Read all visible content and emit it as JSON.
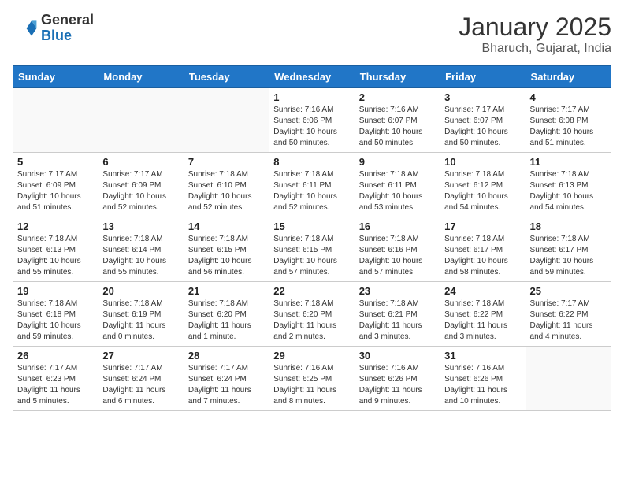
{
  "header": {
    "logo_line1": "General",
    "logo_line2": "Blue",
    "month_year": "January 2025",
    "location": "Bharuch, Gujarat, India"
  },
  "weekdays": [
    "Sunday",
    "Monday",
    "Tuesday",
    "Wednesday",
    "Thursday",
    "Friday",
    "Saturday"
  ],
  "weeks": [
    [
      {
        "day": "",
        "info": ""
      },
      {
        "day": "",
        "info": ""
      },
      {
        "day": "",
        "info": ""
      },
      {
        "day": "1",
        "info": "Sunrise: 7:16 AM\nSunset: 6:06 PM\nDaylight: 10 hours\nand 50 minutes."
      },
      {
        "day": "2",
        "info": "Sunrise: 7:16 AM\nSunset: 6:07 PM\nDaylight: 10 hours\nand 50 minutes."
      },
      {
        "day": "3",
        "info": "Sunrise: 7:17 AM\nSunset: 6:07 PM\nDaylight: 10 hours\nand 50 minutes."
      },
      {
        "day": "4",
        "info": "Sunrise: 7:17 AM\nSunset: 6:08 PM\nDaylight: 10 hours\nand 51 minutes."
      }
    ],
    [
      {
        "day": "5",
        "info": "Sunrise: 7:17 AM\nSunset: 6:09 PM\nDaylight: 10 hours\nand 51 minutes."
      },
      {
        "day": "6",
        "info": "Sunrise: 7:17 AM\nSunset: 6:09 PM\nDaylight: 10 hours\nand 52 minutes."
      },
      {
        "day": "7",
        "info": "Sunrise: 7:18 AM\nSunset: 6:10 PM\nDaylight: 10 hours\nand 52 minutes."
      },
      {
        "day": "8",
        "info": "Sunrise: 7:18 AM\nSunset: 6:11 PM\nDaylight: 10 hours\nand 52 minutes."
      },
      {
        "day": "9",
        "info": "Sunrise: 7:18 AM\nSunset: 6:11 PM\nDaylight: 10 hours\nand 53 minutes."
      },
      {
        "day": "10",
        "info": "Sunrise: 7:18 AM\nSunset: 6:12 PM\nDaylight: 10 hours\nand 54 minutes."
      },
      {
        "day": "11",
        "info": "Sunrise: 7:18 AM\nSunset: 6:13 PM\nDaylight: 10 hours\nand 54 minutes."
      }
    ],
    [
      {
        "day": "12",
        "info": "Sunrise: 7:18 AM\nSunset: 6:13 PM\nDaylight: 10 hours\nand 55 minutes."
      },
      {
        "day": "13",
        "info": "Sunrise: 7:18 AM\nSunset: 6:14 PM\nDaylight: 10 hours\nand 55 minutes."
      },
      {
        "day": "14",
        "info": "Sunrise: 7:18 AM\nSunset: 6:15 PM\nDaylight: 10 hours\nand 56 minutes."
      },
      {
        "day": "15",
        "info": "Sunrise: 7:18 AM\nSunset: 6:15 PM\nDaylight: 10 hours\nand 57 minutes."
      },
      {
        "day": "16",
        "info": "Sunrise: 7:18 AM\nSunset: 6:16 PM\nDaylight: 10 hours\nand 57 minutes."
      },
      {
        "day": "17",
        "info": "Sunrise: 7:18 AM\nSunset: 6:17 PM\nDaylight: 10 hours\nand 58 minutes."
      },
      {
        "day": "18",
        "info": "Sunrise: 7:18 AM\nSunset: 6:17 PM\nDaylight: 10 hours\nand 59 minutes."
      }
    ],
    [
      {
        "day": "19",
        "info": "Sunrise: 7:18 AM\nSunset: 6:18 PM\nDaylight: 10 hours\nand 59 minutes."
      },
      {
        "day": "20",
        "info": "Sunrise: 7:18 AM\nSunset: 6:19 PM\nDaylight: 11 hours\nand 0 minutes."
      },
      {
        "day": "21",
        "info": "Sunrise: 7:18 AM\nSunset: 6:20 PM\nDaylight: 11 hours\nand 1 minute."
      },
      {
        "day": "22",
        "info": "Sunrise: 7:18 AM\nSunset: 6:20 PM\nDaylight: 11 hours\nand 2 minutes."
      },
      {
        "day": "23",
        "info": "Sunrise: 7:18 AM\nSunset: 6:21 PM\nDaylight: 11 hours\nand 3 minutes."
      },
      {
        "day": "24",
        "info": "Sunrise: 7:18 AM\nSunset: 6:22 PM\nDaylight: 11 hours\nand 3 minutes."
      },
      {
        "day": "25",
        "info": "Sunrise: 7:17 AM\nSunset: 6:22 PM\nDaylight: 11 hours\nand 4 minutes."
      }
    ],
    [
      {
        "day": "26",
        "info": "Sunrise: 7:17 AM\nSunset: 6:23 PM\nDaylight: 11 hours\nand 5 minutes."
      },
      {
        "day": "27",
        "info": "Sunrise: 7:17 AM\nSunset: 6:24 PM\nDaylight: 11 hours\nand 6 minutes."
      },
      {
        "day": "28",
        "info": "Sunrise: 7:17 AM\nSunset: 6:24 PM\nDaylight: 11 hours\nand 7 minutes."
      },
      {
        "day": "29",
        "info": "Sunrise: 7:16 AM\nSunset: 6:25 PM\nDaylight: 11 hours\nand 8 minutes."
      },
      {
        "day": "30",
        "info": "Sunrise: 7:16 AM\nSunset: 6:26 PM\nDaylight: 11 hours\nand 9 minutes."
      },
      {
        "day": "31",
        "info": "Sunrise: 7:16 AM\nSunset: 6:26 PM\nDaylight: 11 hours\nand 10 minutes."
      },
      {
        "day": "",
        "info": ""
      }
    ]
  ]
}
